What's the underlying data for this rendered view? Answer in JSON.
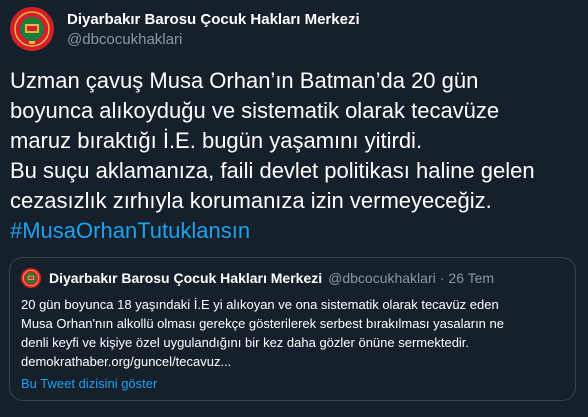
{
  "tweet": {
    "display_name": "Diyarbakır Barosu Çocuk Hakları Merkezi",
    "handle": "@dbcocukhaklari",
    "avatar_icon": "bar-association-seal-icon",
    "text_lines": [
      "Uzman çavuş Musa Orhan’ın Batman’da 20 gün",
      "boyunca alıkoyduğu ve sistematik olarak tecavüze",
      "maruz bıraktığı İ.E. bugün yaşamını yitirdi.",
      "Bu suçu aklamanıza, faili devlet politikası haline gelen",
      "cezasızlık zırhıyla korumanıza izin vermeyeceğiz."
    ],
    "hashtag": "#MusaOrhanTutuklansın"
  },
  "quoted": {
    "display_name": "Diyarbakır Barosu Çocuk Hakları Merkezi",
    "handle": "@dbcocukhaklari",
    "separator": "·",
    "date": "26 Tem",
    "text_lines": [
      "20 gün boyunca 18 yaşındaki İ.E yi alıkoyan ve ona sistematik olarak tecavüz eden",
      "Musa Orhan'nın alkollü olması gerekçe gösterilerek serbest bırakılması yasaların ne",
      "denli keyfi ve kişiye özel uygulandığını bir kez daha gözler önüne sermektedir.",
      "demokrathaber.org/guncel/tecavuz..."
    ],
    "show_thread": "Bu Tweet dizisini göster"
  },
  "colors": {
    "background": "#15202b",
    "accent": "#1da1f2",
    "secondary_text": "#8899a6",
    "border": "#38444d",
    "avatar_red": "#d31f2b",
    "avatar_green": "#1e7a3c",
    "avatar_gold": "#e5b93a"
  }
}
